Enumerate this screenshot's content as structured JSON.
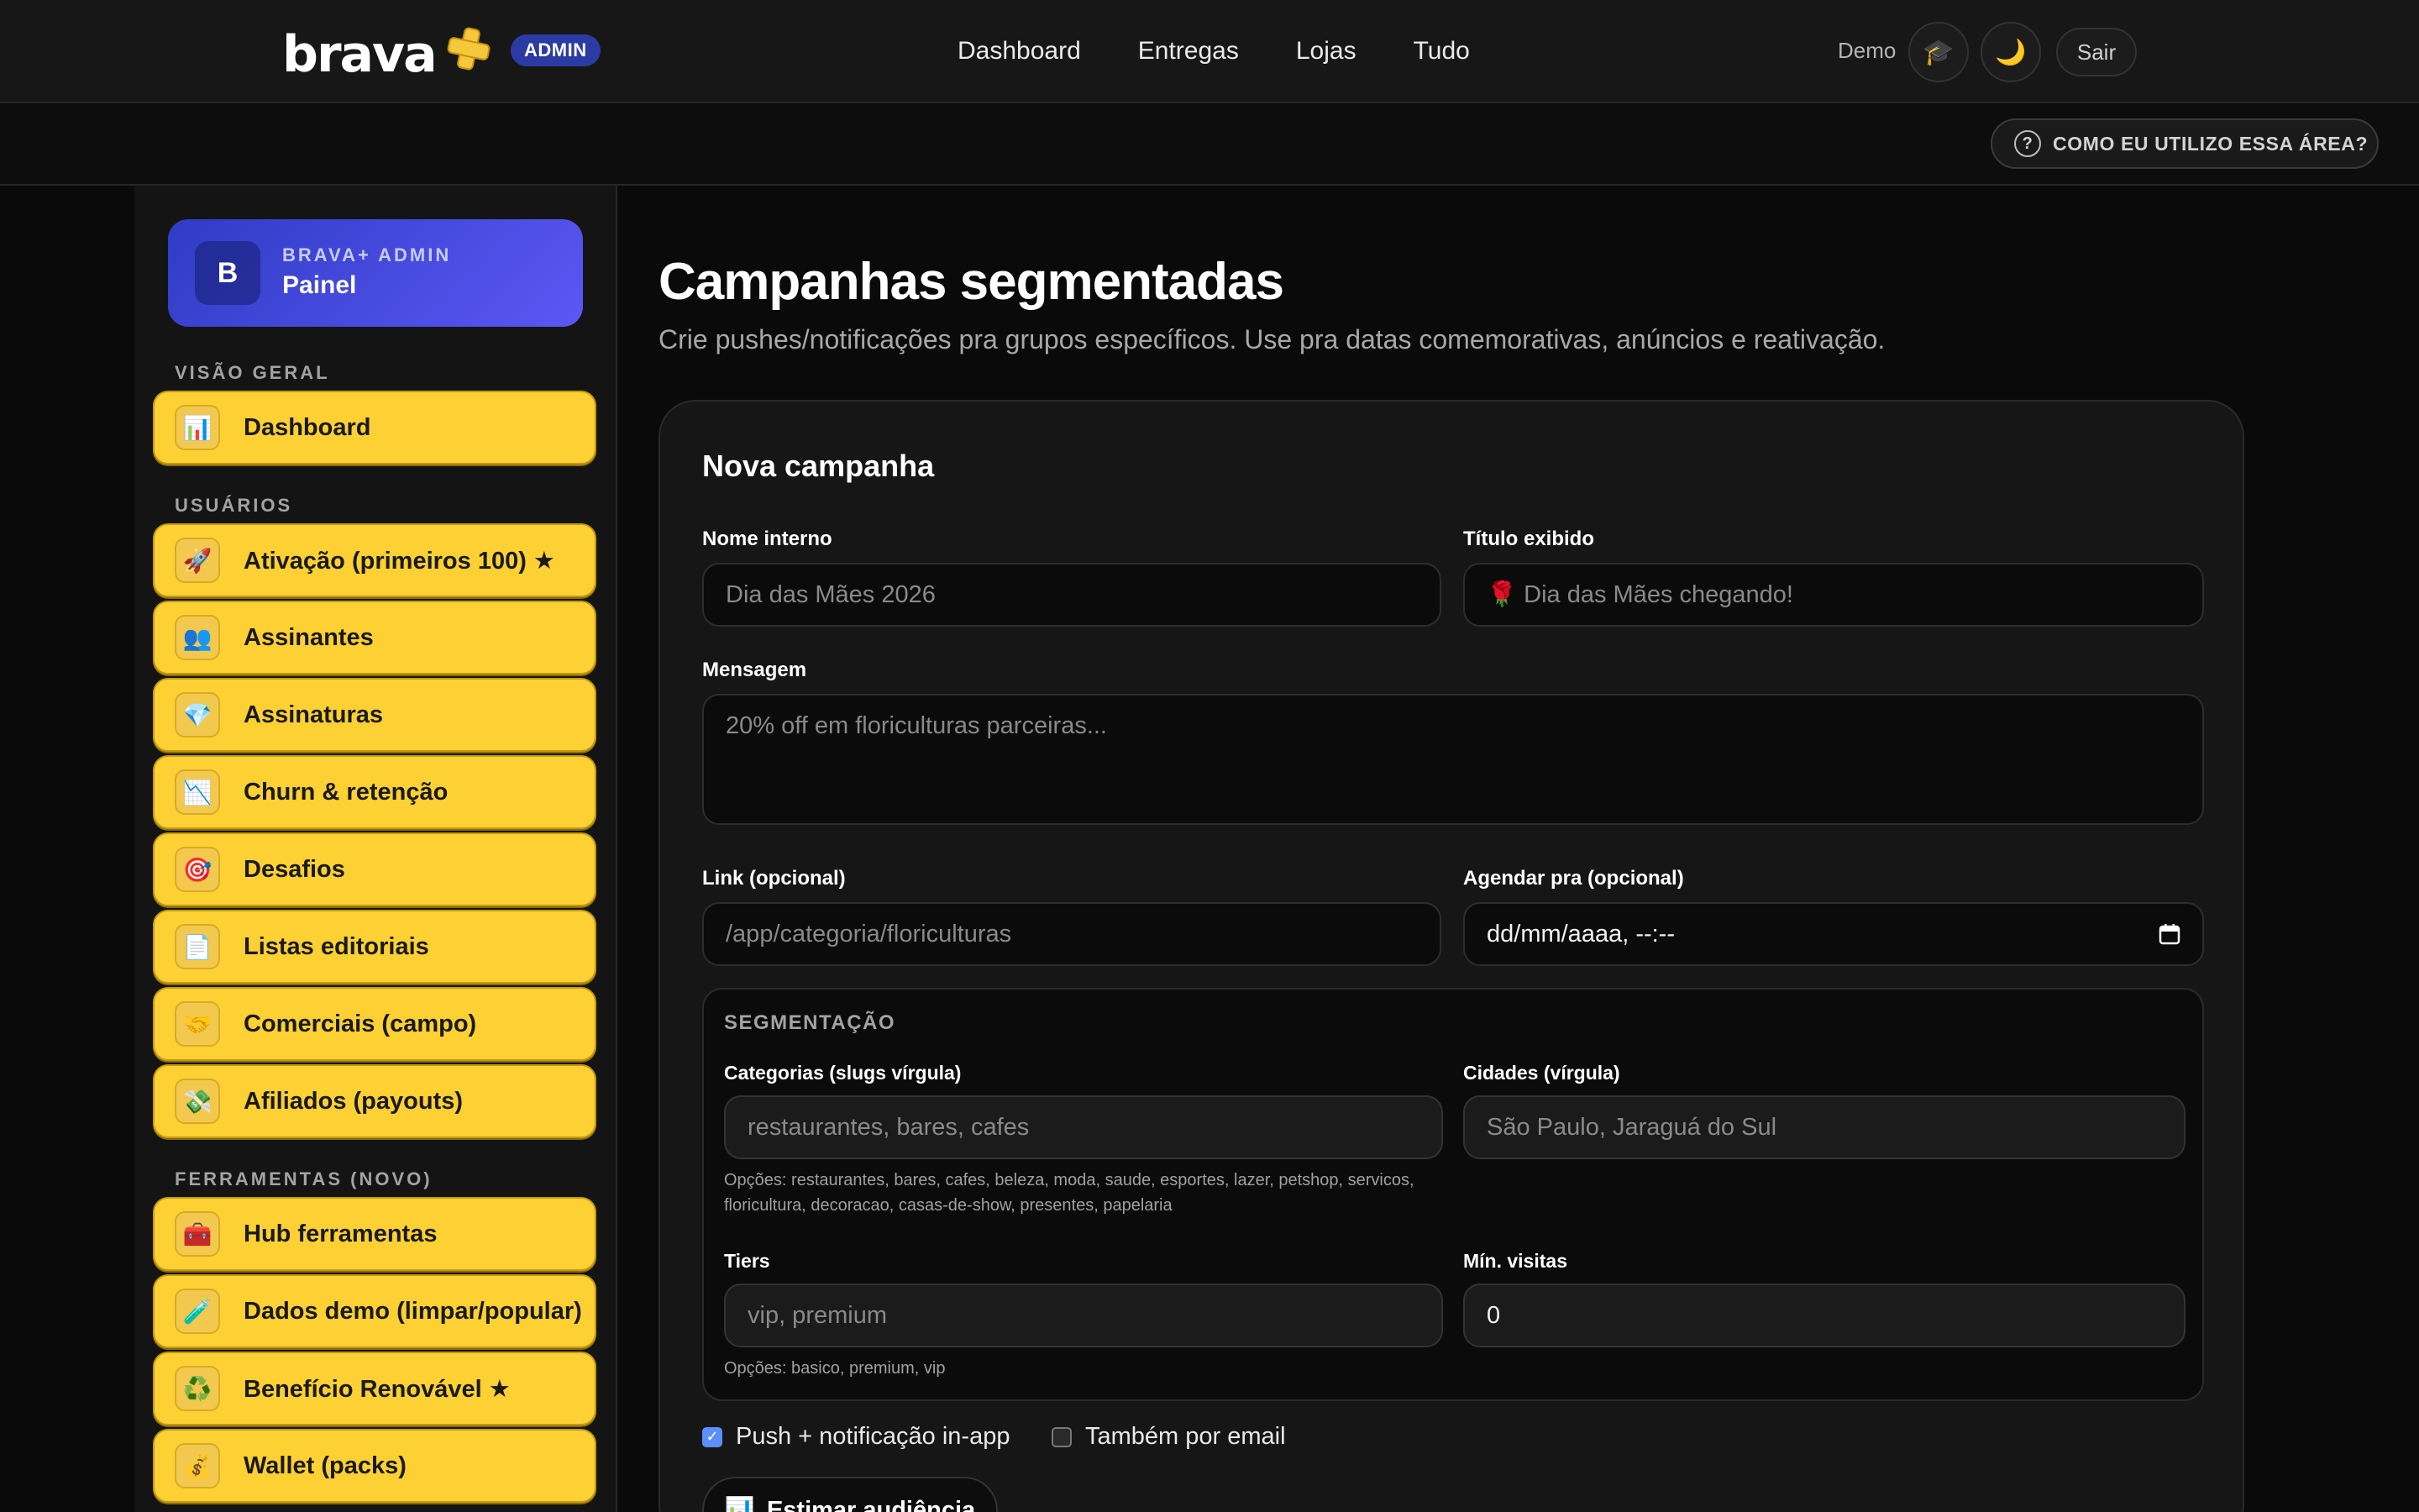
{
  "header": {
    "logo": "brava",
    "admin_badge": "ADMIN",
    "nav": [
      "Dashboard",
      "Entregas",
      "Lojas",
      "Tudo"
    ],
    "demo_label": "Demo",
    "icons": [
      "graduation-cap-icon",
      "moon-icon"
    ],
    "logout": "Sair"
  },
  "helpbar": {
    "help_label": "COMO EU UTILIZO ESSA ÁREA?"
  },
  "sidebar": {
    "brand_subtitle": "BRAVA+ ADMIN",
    "brand_title": "Painel",
    "brand_initial": "B",
    "sections": [
      {
        "label": "VISÃO GERAL"
      },
      {
        "label": "USUÁRIOS"
      },
      {
        "label": "FERRAMENTAS (NOVO)"
      }
    ],
    "items": [
      {
        "label": "Dashboard",
        "icon": "📊"
      },
      {
        "label": "Ativação (primeiros 100) ★",
        "icon": "🚀"
      },
      {
        "label": "Assinantes",
        "icon": "👥"
      },
      {
        "label": "Assinaturas",
        "icon": "💎"
      },
      {
        "label": "Churn & retenção",
        "icon": "📉"
      },
      {
        "label": "Desafios",
        "icon": "🎯"
      },
      {
        "label": "Listas editoriais",
        "icon": "📄"
      },
      {
        "label": "Comerciais (campo)",
        "icon": "🤝"
      },
      {
        "label": "Afiliados (payouts)",
        "icon": "💸"
      },
      {
        "label": "Hub ferramentas",
        "icon": "🧰"
      },
      {
        "label": "Dados demo (limpar/popular)",
        "icon": "🧪"
      },
      {
        "label": "Benefício Renovável ★",
        "icon": "♻️"
      },
      {
        "label": "Wallet (packs)",
        "icon": "💰"
      }
    ]
  },
  "main": {
    "title": "Campanhas segmentadas",
    "subtitle": "Crie pushes/notificações pra grupos específicos. Use pra datas comemorativas, anúncios e reativação.",
    "card_title": "Nova campanha",
    "fields": {
      "internal_name": {
        "label": "Nome interno",
        "placeholder": "Dia das Mães 2026"
      },
      "display_title": {
        "label": "Título exibido",
        "placeholder": "🌹 Dia das Mães chegando!"
      },
      "message": {
        "label": "Mensagem",
        "placeholder": "20% off em floriculturas parceiras..."
      },
      "link": {
        "label": "Link (opcional)",
        "placeholder": "/app/categoria/floriculturas"
      },
      "schedule": {
        "label": "Agendar pra (opcional)",
        "value": "dd/mm/aaaa, --:--"
      }
    },
    "segmentation": {
      "title": "SEGMENTAÇÃO",
      "categories": {
        "label": "Categorias (slugs vírgula)",
        "placeholder": "restaurantes, bares, cafes",
        "hint": "Opções: restaurantes, bares, cafes, beleza, moda, saude, esportes, lazer, petshop, servicos, floricultura, decoracao, casas-de-show, presentes, papelaria"
      },
      "cities": {
        "label": "Cidades (vírgula)",
        "placeholder": "São Paulo, Jaraguá do Sul"
      },
      "tiers": {
        "label": "Tiers",
        "placeholder": "vip, premium",
        "hint": "Opções: basico, premium, vip"
      },
      "min_visits": {
        "label": "Mín. visitas",
        "value": "0"
      }
    },
    "checkboxes": [
      {
        "label": "Push + notificação in-app",
        "checked": true
      },
      {
        "label": "Também por email",
        "checked": false
      }
    ],
    "estimate_button": "Estimar audiência"
  }
}
